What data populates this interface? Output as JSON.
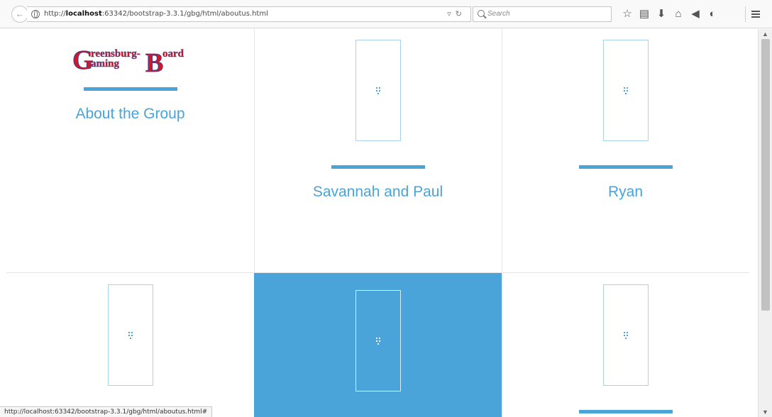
{
  "browser": {
    "url_prefix": "http://",
    "url_host": "localhost",
    "url_rest": ":63342/bootstrap-3.3.1/gbg/html/aboutus.html",
    "search_placeholder": "Search",
    "status_url": "http://localhost:63342/bootstrap-3.3.1/gbg/html/aboutus.html#",
    "toolbar_icons": [
      "star-icon",
      "reading-list-icon",
      "download-icon",
      "home-icon",
      "send-icon",
      "pocket-icon"
    ],
    "toolbar_glyphs": [
      "☆",
      "▤",
      "⬇",
      "⌂",
      "◀",
      "◐"
    ]
  },
  "page": {
    "logo": {
      "line1": "reensburg-",
      "line2": "aming",
      "word2": "oard",
      "initial_g": "G",
      "initial_b": "B"
    },
    "about_heading": "About the Group",
    "cards": [
      {
        "name": "Savannah and Paul"
      },
      {
        "name": "Ryan"
      }
    ]
  },
  "colors": {
    "accent": "#4aa3d9",
    "logo_red": "#d1172b",
    "logo_outline": "#2b3f8f"
  }
}
